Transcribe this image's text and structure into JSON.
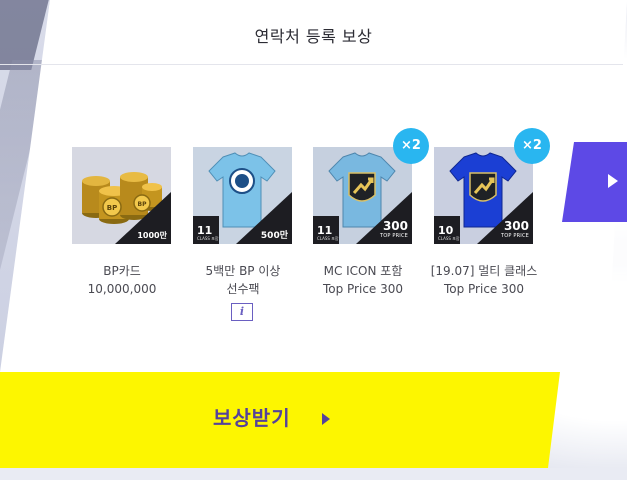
{
  "header": {
    "title": "연락처 등록 보상"
  },
  "rewards": [
    {
      "name_line1": "BP카드",
      "name_line2": "10,000,000",
      "corner_value": "1000만",
      "multiplier": null
    },
    {
      "name_line1": "5백만 BP 이상",
      "name_line2": "선수팩",
      "ovr": "11",
      "ovr_caption": "CLASS 포함",
      "corner_value": "500만",
      "multiplier": null,
      "info_label": "i"
    },
    {
      "name_line1": "MC ICON 포함",
      "name_line2": "Top Price 300",
      "ovr": "11",
      "ovr_caption": "CLASS 포함",
      "corner_value": "300",
      "corner_caption": "TOP PRICE",
      "multiplier": "×2"
    },
    {
      "name_line1": "[19.07] 멀티 클래스",
      "name_line2": "Top Price 300",
      "ovr": "10",
      "ovr_caption": "CLASS 포함",
      "corner_value": "300",
      "corner_caption": "TOP PRICE",
      "multiplier": "×2"
    }
  ],
  "claim": {
    "label": "보상받기"
  },
  "colors": {
    "accent_purple": "#5d49e6",
    "claim_yellow": "#fdf600",
    "badge_blue": "#29b6f0",
    "claim_text": "#55429a"
  },
  "icons": {
    "next": "chevron-right-icon",
    "claim": "play-arrow-icon",
    "info": "info-icon"
  }
}
